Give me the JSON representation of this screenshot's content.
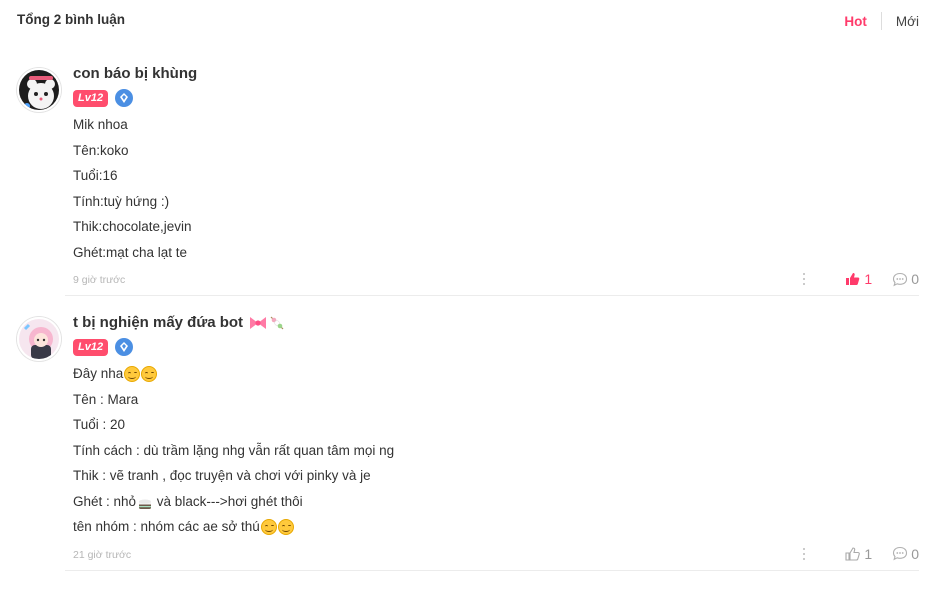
{
  "header": {
    "total_label": "Tổng 2 bình luận",
    "sort_hot": "Hot",
    "sort_new": "Mới"
  },
  "comments": [
    {
      "username": "con báo bị khùng",
      "level": "Lv12",
      "lines": [
        "Mik nhoa",
        "Tên:koko",
        "Tuổi:16",
        "Tính:tuỳ hứng :)",
        "Thik:chocolate,jevin",
        "Ghét:mạt cha lạt te"
      ],
      "time": "9 giờ trước",
      "likes": "1",
      "replies": "0",
      "liked": true
    },
    {
      "username": "t bị nghiện mấy đứa bot",
      "level": "Lv12",
      "lines": [
        "Đây nha",
        "Tên : Mara",
        "Tuổi : 20",
        "Tính cách : dù trầm lặng nhg vẫn rất quan tâm mọi ng",
        "Thik : vẽ tranh , đọc truyện và chơi với pinky và je",
        "Ghét : nhỏ",
        "tên nhóm : nhóm các ae sở thú"
      ],
      "line_suffix": {
        "ghet_rest": " và black--->hơi ghét thôi"
      },
      "time": "21 giờ trước",
      "likes": "1",
      "replies": "0",
      "liked": false
    }
  ],
  "colors": {
    "accent": "#ff3b6b",
    "level_badge": "#ff4d6d",
    "vip_badge": "#4b8fe3"
  },
  "icons": [
    "ribbon-bow-icon",
    "skewer-icon",
    "smile-emoji-icon",
    "relieved-emoji-icon",
    "cake-emoji-icon",
    "vip-diamond-icon",
    "more-options-icon",
    "like-thumb-icon",
    "reply-bubble-icon"
  ]
}
